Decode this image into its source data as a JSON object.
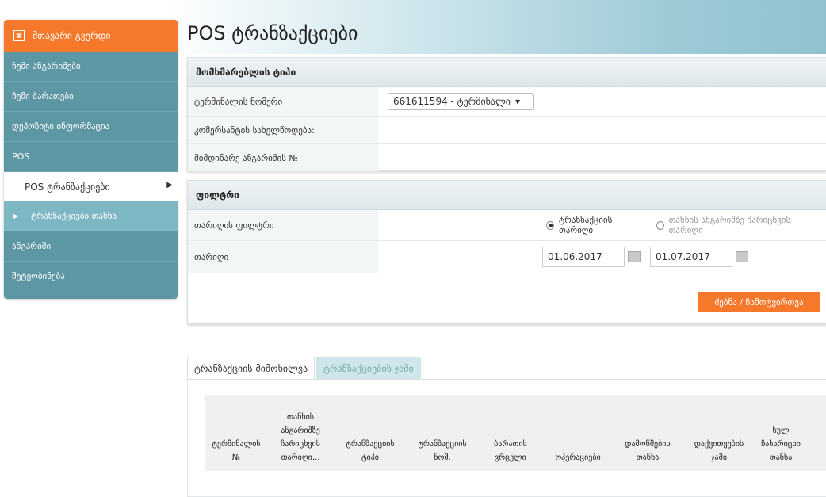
{
  "page_title": "POS ტრანზაქციები",
  "colors": {
    "accent": "#f6782b",
    "sidebar": "#5d97a4",
    "sidebar_sub": "#7eb7c4"
  },
  "sidebar": {
    "header": "მთავარი გვერდი",
    "items": [
      {
        "label": "ჩემი ანგარიშები"
      },
      {
        "label": "ჩემი ბარათები"
      },
      {
        "label": "დეპოზიტი ინფორმაცია"
      },
      {
        "label": "POS"
      },
      {
        "label": "POS ტრანზაქციები"
      },
      {
        "label": "ტრანზაქციები თანხა"
      },
      {
        "label": "ანგარიში"
      },
      {
        "label": "შეტყობინება"
      }
    ]
  },
  "details_panel": {
    "title": "მომხმარებლის ტიპი",
    "rows": [
      {
        "label": "ტერმინალის ნომერი",
        "value": "661611594 - ტერმინალი"
      },
      {
        "label": "კომერსანტის სახელწოდება:",
        "value": ""
      },
      {
        "label": "მიმდინარე ანგარიშის №",
        "value": ""
      }
    ]
  },
  "filter_panel": {
    "title": "ფილტრი",
    "type_label": "თარიღის ფილტრი",
    "radio_1": "ტრანზაქციის თარიღი",
    "radio_2": "თანხის ანგარიშზე ჩარიცხვის თარიღი",
    "date_label": "თარიღი",
    "date_from": "01.06.2017",
    "date_to": "01.07.2017",
    "search_button": "ძებნა / ჩამოტვირთვა"
  },
  "tabs": [
    {
      "label": "ტრანზაქციის მიმოხილვა"
    },
    {
      "label": "ტრანზაქციების ჯამი"
    }
  ],
  "table": {
    "headers": [
      "ტერმინალის №",
      "თანხის ანგარიშზე ჩარიცხვის თარიღი...",
      "ტრანზაქციის ტიპი",
      "ტრანზაქციის ნომ.",
      "ბარათის ვრცელი",
      "ოპერაციები",
      "დამოწმების თანხა",
      "დაქვითვების ჯამი",
      "სულ ჩასარიცხი თანხა"
    ]
  }
}
